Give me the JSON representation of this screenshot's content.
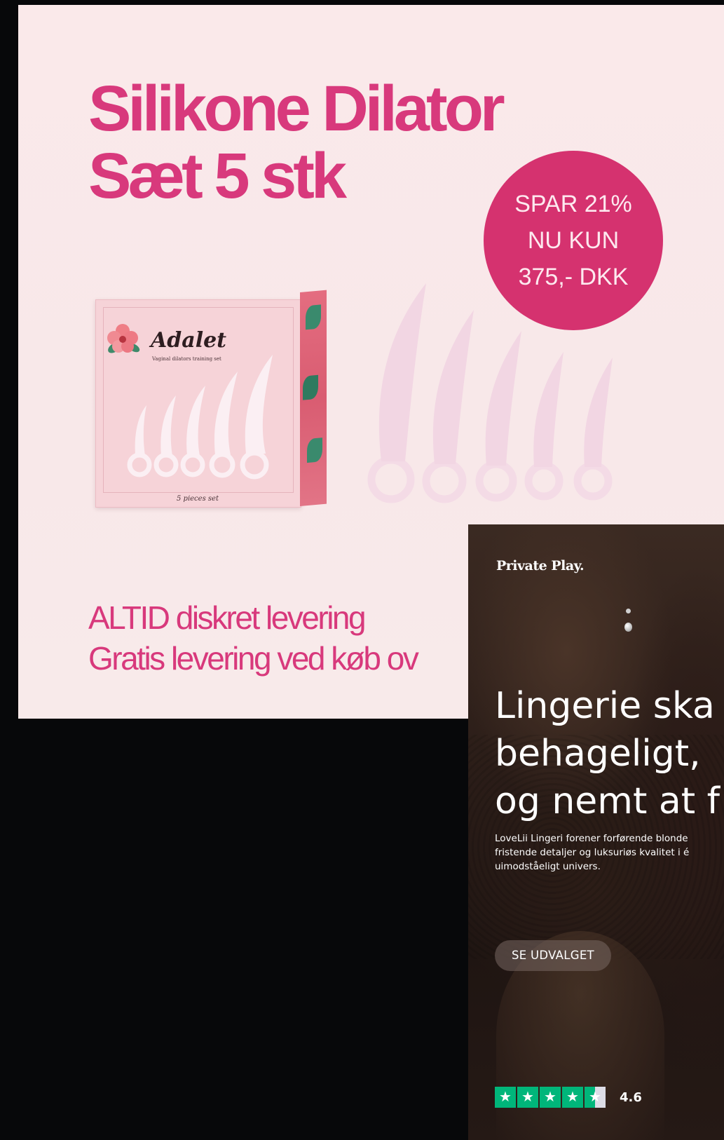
{
  "ad_dilator": {
    "title_line1": "Silikone Dilator",
    "title_line2": "Sæt 5 stk",
    "badge": {
      "line1": "SPAR 21%",
      "line2": "NU KUN",
      "line3": "375,- DKK"
    },
    "package": {
      "brand": "Adalet",
      "subtitle": "Vaginal dilators training set",
      "pieces": "5 pieces set"
    },
    "footer_line1": "ALTID diskret levering",
    "footer_line2": "Gratis levering ved køb ov",
    "colors": {
      "accent": "#d8397c",
      "badge": "#d5326f",
      "background": "#f8e8e9"
    }
  },
  "ad_lingerie": {
    "brand": "Private Play.",
    "headline_line1": "Lingerie ska",
    "headline_line2": "behageligt,",
    "headline_line3": "og nemt at f",
    "description_line1": "LoveLii Lingeri forener forførende blonde",
    "description_line2": "fristende detaljer og luksuriøs kvalitet i é",
    "description_line3": "uimodståeligt univers.",
    "cta_label": "SE UDVALGET",
    "rating": {
      "value": "4.6",
      "stars_full": 4,
      "stars_half": 1,
      "star_icon": "star-icon",
      "star_color": "#00b67a"
    }
  }
}
